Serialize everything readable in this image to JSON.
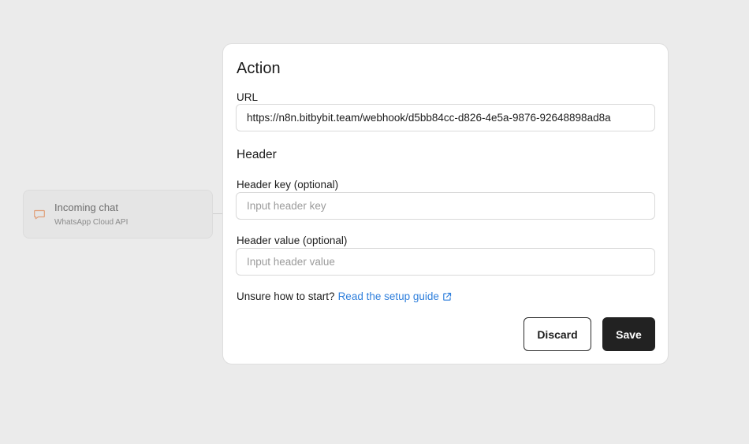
{
  "node": {
    "title": "Incoming chat",
    "subtitle": "WhatsApp Cloud API",
    "icon": "chat-bubble-icon",
    "icon_color": "#e0a07a"
  },
  "panel": {
    "title": "Action",
    "url": {
      "label": "URL",
      "value": "https://n8n.bitbybit.team/webhook/d5bb84cc-d826-4e5a-9876-92648898ad8a"
    },
    "header_section": "Header",
    "header_key": {
      "label": "Header key (optional)",
      "placeholder": "Input header key",
      "value": ""
    },
    "header_value": {
      "label": "Header value (optional)",
      "placeholder": "Input header value",
      "value": ""
    },
    "help": {
      "prefix": "Unsure how to start?",
      "link_label": "Read the setup guide",
      "link_icon": "external-link-icon"
    },
    "buttons": {
      "discard": "Discard",
      "save": "Save"
    }
  },
  "colors": {
    "background": "#ebebeb",
    "link": "#2f7fdc",
    "primary_button": "#222222"
  }
}
